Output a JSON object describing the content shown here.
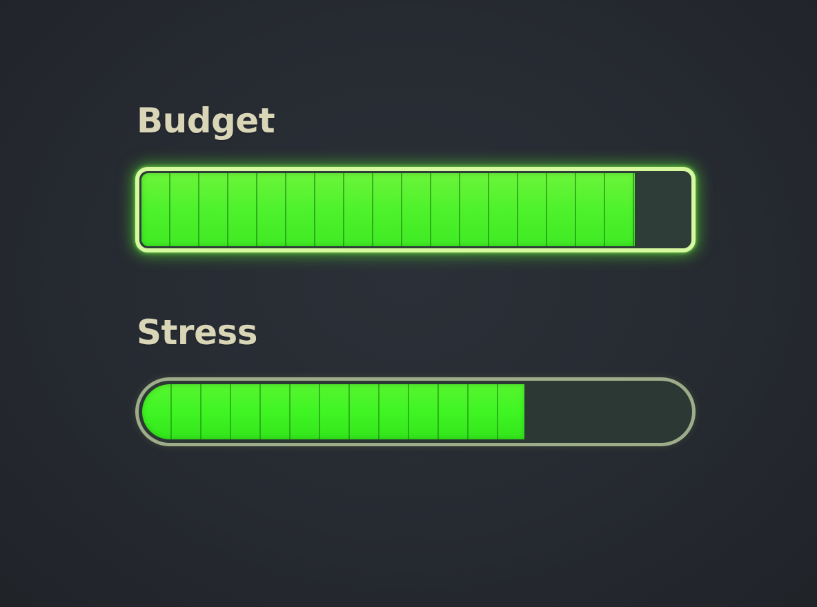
{
  "meters": [
    {
      "label": "Budget",
      "fill_fraction": 0.9,
      "segments_filled": 18,
      "fill_color": "#4ef22c",
      "border_color": "#d6f9a0"
    },
    {
      "label": "Stress",
      "fill_fraction": 0.7,
      "segments_filled": 13,
      "fill_color": "#3ff523",
      "border_color": "#9fac8a"
    }
  ],
  "background_color": "#262a31"
}
